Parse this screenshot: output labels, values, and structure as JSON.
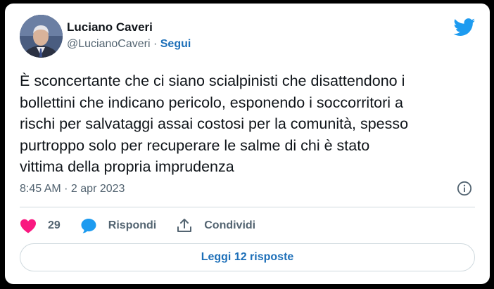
{
  "author": {
    "name": "Luciano Caveri",
    "handle": "@LucianoCaveri",
    "separator": " · ",
    "follow_label": "Segui"
  },
  "tweet": {
    "text": "È sconcertante che ci siano scialpinisti che disattendono i\nbollettini che indicano pericolo, esponendo i soccorritori a\nrischi per salvataggi assai costosi per la comunità, spesso\npurtroppo solo per recuperare le salme di chi è stato\nvittima della propria imprudenza",
    "timestamp": "8:45 AM · 2 apr 2023"
  },
  "actions": {
    "like_count": "29",
    "reply_label": "Rispondi",
    "share_label": "Condividi"
  },
  "footer": {
    "read_replies_label": "Leggi 12 risposte"
  },
  "icons": {
    "brand": "twitter-bird-icon",
    "like": "heart-icon",
    "reply": "comment-bubble-icon",
    "share": "share-upload-icon",
    "info": "info-icon"
  },
  "colors": {
    "brand_blue": "#1d9bf0",
    "link_blue": "#1d6fb8",
    "like_pink": "#f91880",
    "secondary_text": "#536471"
  }
}
